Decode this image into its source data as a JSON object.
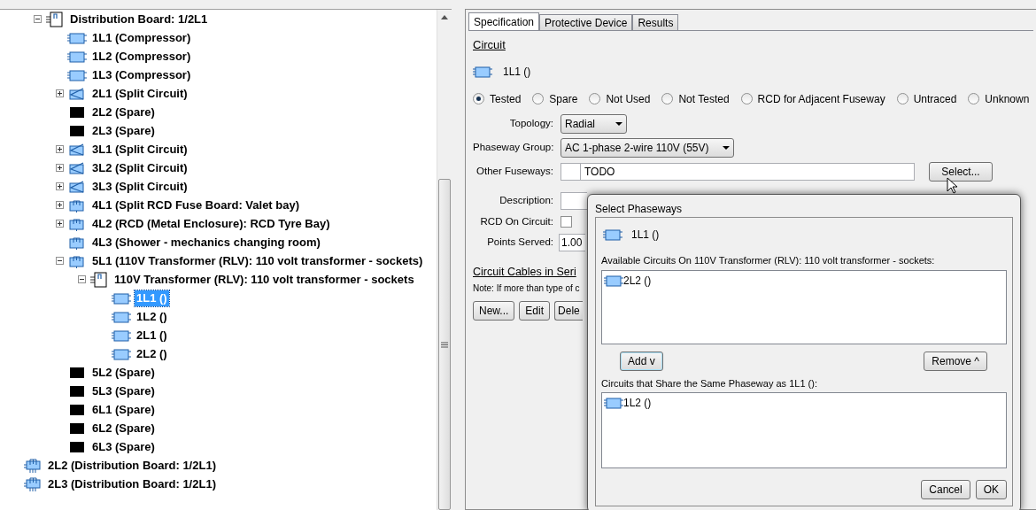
{
  "tree": {
    "scrolled_branch": [
      {
        "label": "Distribution Board: 1/2L1",
        "kind": "board",
        "expanded": true,
        "selected": false,
        "children": [
          {
            "label": "1L1 (Compressor)",
            "kind": "circuit",
            "selected": false
          },
          {
            "label": "1L2 (Compressor)",
            "kind": "circuit",
            "selected": false
          },
          {
            "label": "1L3 (Compressor)",
            "kind": "circuit",
            "selected": false
          },
          {
            "label": "2L1 (Split Circuit)",
            "kind": "split",
            "expanded": false,
            "selected": false
          },
          {
            "label": "2L2 (Spare)",
            "kind": "spare",
            "selected": false
          },
          {
            "label": "2L3 (Spare)",
            "kind": "spare",
            "selected": false
          },
          {
            "label": "3L1 (Split Circuit)",
            "kind": "split",
            "expanded": false,
            "selected": false
          },
          {
            "label": "3L2 (Split Circuit)",
            "kind": "split",
            "expanded": false,
            "selected": false
          },
          {
            "label": "3L3 (Split Circuit)",
            "kind": "split",
            "expanded": false,
            "selected": false
          },
          {
            "label": "4L1 (Split RCD Fuse Board: Valet bay)",
            "kind": "rcd",
            "expanded": false,
            "selected": false
          },
          {
            "label": "4L2 (RCD (Metal Enclosure): RCD Tyre Bay)",
            "kind": "rcd",
            "expanded": false,
            "selected": false
          },
          {
            "label": "4L3 (Shower - mechanics changing room)",
            "kind": "rcd",
            "selected": false
          },
          {
            "label": "5L1 (110V Transformer (RLV): 110 volt transformer - sockets)",
            "kind": "rcd",
            "expanded": true,
            "selected": false,
            "children": [
              {
                "label": "110V Transformer (RLV): 110 volt transformer - sockets",
                "kind": "board",
                "expanded": true,
                "selected": false,
                "children": [
                  {
                    "label": "1L1 ()",
                    "kind": "circuit",
                    "selected": true
                  },
                  {
                    "label": "1L2 ()",
                    "kind": "circuit",
                    "selected": false
                  },
                  {
                    "label": "2L1 ()",
                    "kind": "circuit",
                    "selected": false
                  },
                  {
                    "label": "2L2 ()",
                    "kind": "circuit",
                    "selected": false
                  }
                ]
              }
            ]
          },
          {
            "label": "5L2 (Spare)",
            "kind": "spare",
            "selected": false
          },
          {
            "label": "5L3 (Spare)",
            "kind": "spare",
            "selected": false
          },
          {
            "label": "6L1 (Spare)",
            "kind": "spare",
            "selected": false
          },
          {
            "label": "6L2 (Spare)",
            "kind": "spare",
            "selected": false
          },
          {
            "label": "6L3 (Spare)",
            "kind": "spare",
            "selected": false
          }
        ]
      }
    ],
    "items": [
      {
        "label": "2L2 (Distribution Board: 1/2L1)",
        "kind": "db",
        "selected": false
      },
      {
        "label": "2L3 (Distribution Board: 1/2L1)",
        "kind": "db",
        "selected": false
      }
    ]
  },
  "tabs": [
    {
      "label": "Specification",
      "selected": true
    },
    {
      "label": "Protective Device",
      "selected": false
    },
    {
      "label": "Results",
      "selected": false
    }
  ],
  "circuit": {
    "heading": "Circuit",
    "name": "1L1 ()",
    "status_options": [
      {
        "label": "Tested",
        "selected": true
      },
      {
        "label": "Spare",
        "selected": false
      },
      {
        "label": "Not Used",
        "selected": false
      },
      {
        "label": "Not Tested",
        "selected": false
      },
      {
        "label": "RCD for Adjacent Fuseway",
        "selected": false
      },
      {
        "label": "Untraced",
        "selected": false
      },
      {
        "label": "Unknown",
        "selected": false
      }
    ],
    "topology": {
      "label": "Topology:",
      "value": "Radial"
    },
    "phaseway_group": {
      "label": "Phaseway Group:",
      "value": "AC 1-phase 2-wire 110V (55V)"
    },
    "other_fuseways": {
      "label": "Other Fuseways:",
      "value": "TODO",
      "button": "Select..."
    },
    "description": {
      "label": "Description:"
    },
    "rcd_on_circuit": {
      "label": "RCD On Circuit:",
      "checked": false
    },
    "points_served": {
      "label": "Points Served:",
      "value": "1.00"
    },
    "cables_heading": "Circuit Cables in Seri",
    "note": "Note: If more than type of c",
    "buttons": [
      "New...",
      "Edit",
      "Dele"
    ]
  },
  "dialog": {
    "title": "Select Phaseways",
    "circuit": "1L1 ()",
    "available_label": "Available Circuits On 110V Transformer (RLV): 110 volt transformer - sockets:",
    "available": [
      "2L2 ()"
    ],
    "add_button": "Add v",
    "remove_button": "Remove ^",
    "shared_label": "Circuits that Share the Same Phaseway as 1L1 ():",
    "shared": [
      "1L2 ()"
    ],
    "buttons": [
      "Cancel",
      "OK"
    ]
  }
}
